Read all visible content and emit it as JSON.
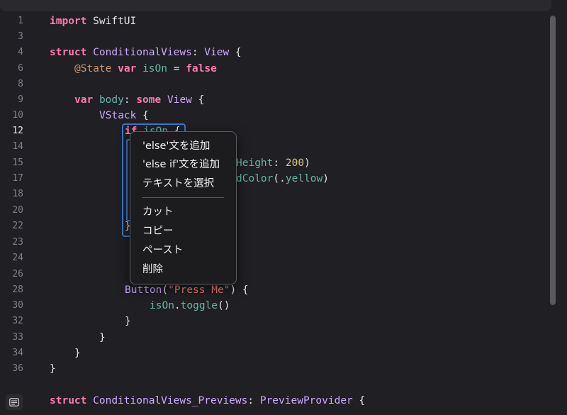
{
  "editor": {
    "line_numbers": [
      "1",
      "3",
      "4",
      "6",
      "8",
      "9",
      "10",
      "12",
      "14",
      "15",
      "17",
      "18",
      "20",
      "22",
      "23",
      "24",
      "26",
      "28",
      "30",
      "32",
      "33",
      "34",
      "36"
    ],
    "current_line": "12",
    "code": {
      "l1_kw": "import",
      "l1_mod": " SwiftUI",
      "l4_kw": "struct",
      "l4_name": "ConditionalViews",
      "l4_colon": ": ",
      "l4_type": "View",
      "l4_brace": " {",
      "l6_attr": "@State",
      "l6_kw": "var",
      "l6_ident": "isOn",
      "l6_eq": " = ",
      "l6_val": "false",
      "l9_kw": "var",
      "l9_ident": "body",
      "l9_colon": ": ",
      "l9_some": "some",
      "l9_type": "View",
      "l9_brace": " {",
      "l10_type": "VStack",
      "l10_brace": " {",
      "l12_kw": "if",
      "l12_ident": "isOn",
      "l12_brace": " {",
      "l15_frag_ident": "Height",
      "l15_frag_colon": ": ",
      "l15_num": "200",
      "l15_paren": ")",
      "l17_frag_ident": "dColor",
      "l17_frag_open": "(",
      "l17_dot": ".",
      "l17_val": "yellow",
      "l17_close": ")",
      "l20_brace": "}",
      "l26_type": "Button",
      "l26_open": "(",
      "l26_str": "\"Press Me\"",
      "l26_close": ") {",
      "l28_ident": "isOn",
      "l28_dot": ".",
      "l28_fn": "toggle",
      "l28_parens": "()",
      "l30_brace": "}",
      "l32_brace": "}",
      "l33_brace": "}",
      "l34_brace": "}",
      "l36_kw": "struct",
      "l36_name": "ConditionalViews_Previews",
      "l36_colon": ": ",
      "l36_type": "PreviewProvider",
      "l36_brace": " {"
    }
  },
  "context_menu": {
    "items_top": [
      "'else'文を追加",
      "'else if'文を追加",
      "テキストを選択"
    ],
    "items_bottom": [
      "カット",
      "コピー",
      "ペースト",
      "削除"
    ]
  },
  "icons": {
    "bottom_left": "text-bubble-icon"
  }
}
